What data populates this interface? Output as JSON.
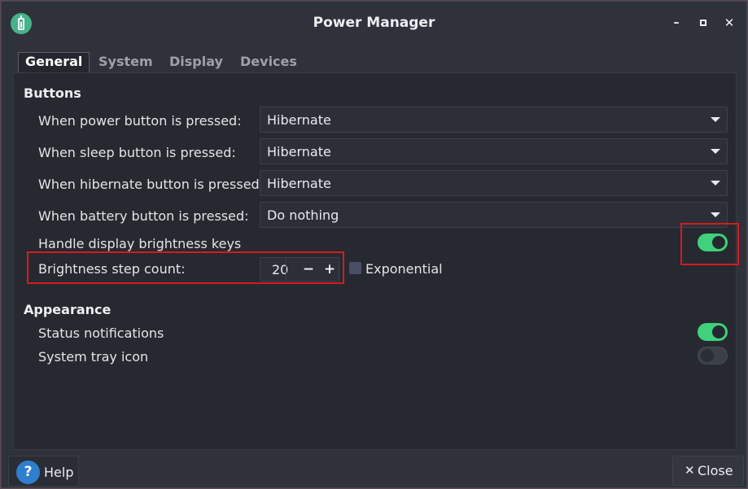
{
  "window": {
    "title": "Power Manager",
    "app_icon": "battery-icon",
    "controls": {
      "minimize": "–",
      "maximize": "",
      "close": "✕"
    }
  },
  "tabs": [
    {
      "label": "General",
      "active": true
    },
    {
      "label": "System",
      "active": false
    },
    {
      "label": "Display",
      "active": false
    },
    {
      "label": "Devices",
      "active": false
    }
  ],
  "buttons_section": {
    "title": "Buttons",
    "rows": [
      {
        "label": "When power button is pressed:",
        "value": "Hibernate"
      },
      {
        "label": "When sleep button is pressed:",
        "value": "Hibernate"
      },
      {
        "label": "When hibernate button is pressed:",
        "value": "Hibernate"
      },
      {
        "label": "When battery button is pressed:",
        "value": "Do nothing"
      }
    ],
    "brightness_keys": {
      "label": "Handle display brightness keys",
      "enabled": true
    },
    "step_count": {
      "label": "Brightness step count:",
      "value": "20",
      "minus": "−",
      "plus": "+",
      "exponential_label": "Exponential",
      "exponential_checked": false
    }
  },
  "appearance_section": {
    "title": "Appearance",
    "status_notifications": {
      "label": "Status notifications",
      "enabled": true
    },
    "system_tray_icon": {
      "label": "System tray icon",
      "enabled": false
    }
  },
  "footer": {
    "help_icon": "?",
    "help_label": "Help",
    "close_icon": "✕",
    "close_label": "Close"
  },
  "colors": {
    "accent_green": "#3fd17b",
    "highlight_red": "#d61a24",
    "help_blue": "#2f7fcf"
  }
}
